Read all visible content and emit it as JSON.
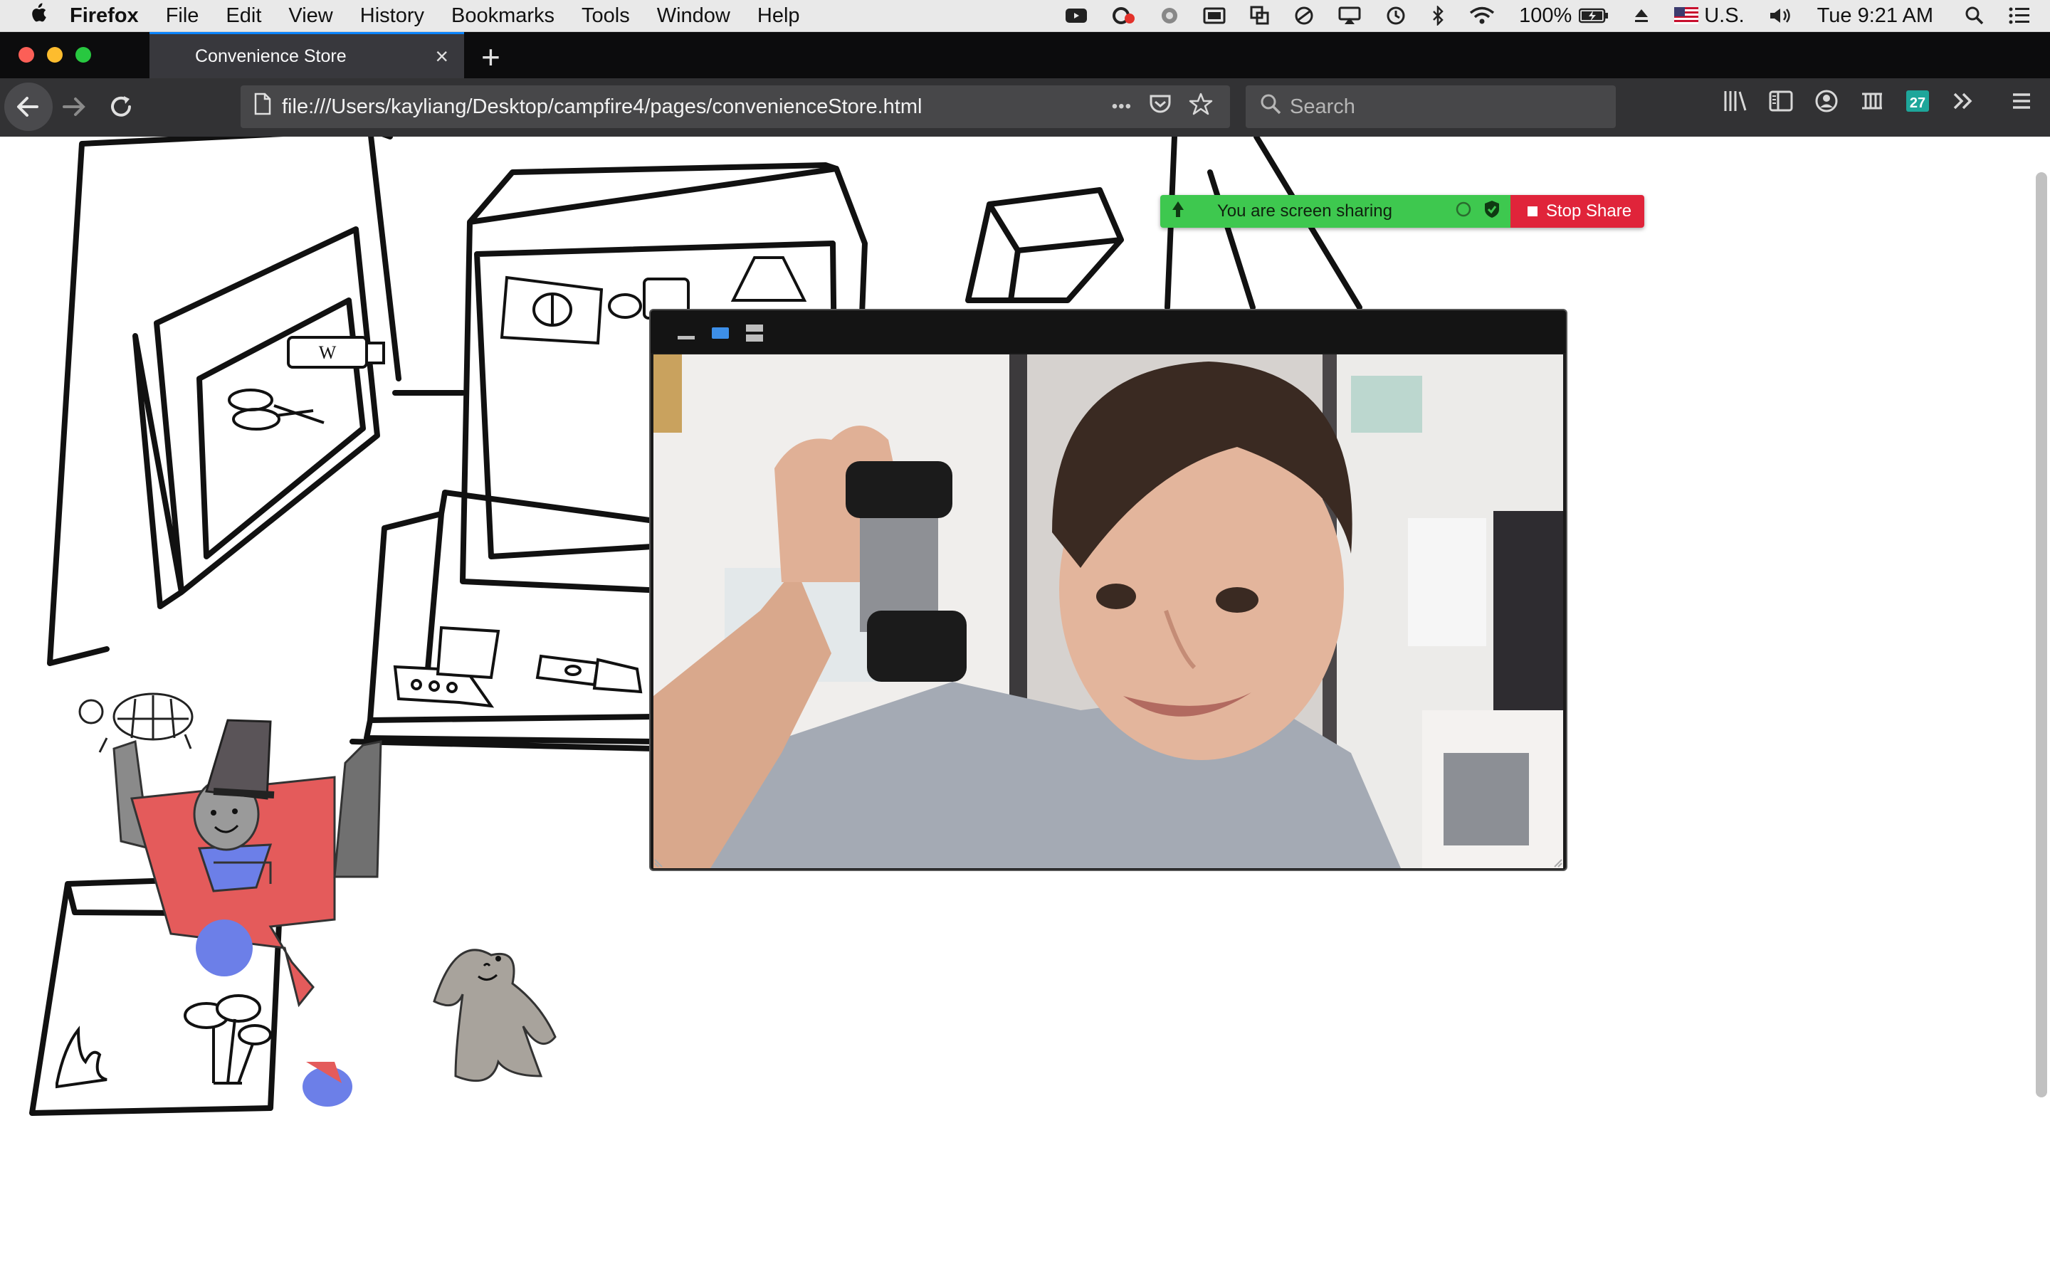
{
  "menubar": {
    "apple": "",
    "app_name": "Firefox",
    "items": [
      "File",
      "Edit",
      "View",
      "History",
      "Bookmarks",
      "Tools",
      "Window",
      "Help"
    ],
    "battery": "100%",
    "input_source": "U.S.",
    "clock": "Tue 9:21 AM"
  },
  "tab": {
    "title": "Convenience Store",
    "close": "×"
  },
  "newtab": "+",
  "navbar": {
    "url": "file:///Users/kayliang/Desktop/campfire4/pages/convenienceStore.html",
    "more": "•••",
    "search_placeholder": "Search"
  },
  "share": {
    "status": "You are screen sharing",
    "stop_label": "Stop Share"
  },
  "colors": {
    "share_green": "#3ec84f",
    "stop_red": "#e0243a",
    "tab_accent": "#0a84ff"
  }
}
